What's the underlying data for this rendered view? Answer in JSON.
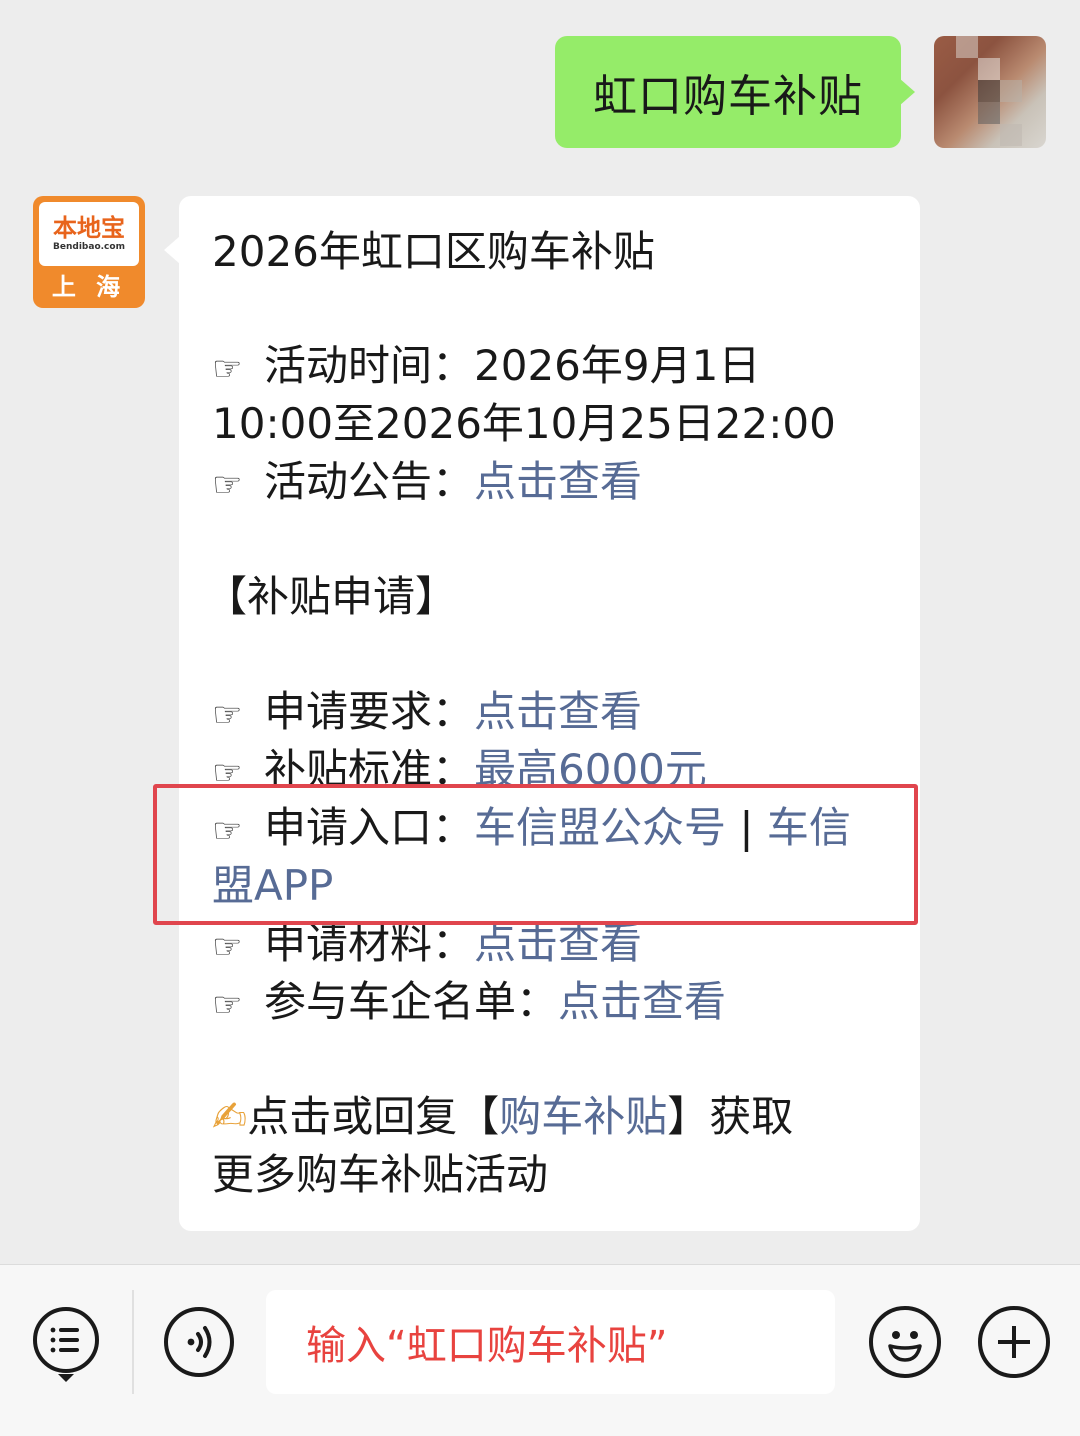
{
  "outgoing": {
    "message": "虹口购车补贴"
  },
  "bot": {
    "avatar": {
      "brand": "本地宝",
      "domain": "Bendibao.com",
      "city": "上 海"
    },
    "message": {
      "title": "2026年虹口区购车补贴",
      "time_label": "活动时间：",
      "time_value_1": "2026年9月1日",
      "time_value_2": "10:00至2026年10月25日22:00",
      "notice_label": "活动公告：",
      "notice_link": "点击查看",
      "section_title": "【补贴申请】",
      "req_label": "申请要求：",
      "req_link": "点击查看",
      "std_label": "补贴标准：",
      "std_link": "最高6000元",
      "entry_label": "申请入口：",
      "entry_link_1": "车信盟公众号",
      "entry_sep": " | ",
      "entry_link_2a": "车信",
      "entry_link_2b": "盟APP",
      "material_label": "申请材料：",
      "material_link": "点击查看",
      "company_label": "参与车企名单：",
      "company_link": "点击查看",
      "footer_emoji": "✍",
      "footer_1a": "点击或回复",
      "footer_bracket_open": "【",
      "footer_link": "购车补贴",
      "footer_bracket_close": "】",
      "footer_1b": "获取",
      "footer_2": "更多购车补贴活动",
      "hand": "☞"
    }
  },
  "bottom_bar": {
    "input_text": "输入“虹口购车补贴”",
    "icons": [
      "menu-list-icon",
      "voice-icon",
      "emoji-icon",
      "plus-icon"
    ]
  },
  "colors": {
    "outgoing_bubble": "#95ec69",
    "link": "#576b95",
    "highlight_box": "#e0454d",
    "input_text": "#e8433f"
  }
}
